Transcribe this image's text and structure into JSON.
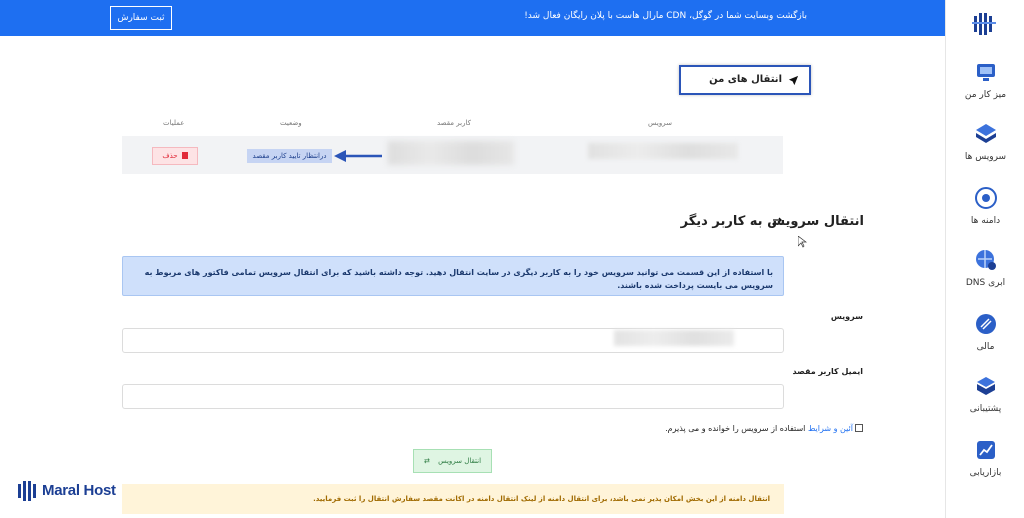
{
  "topbar": {
    "message": "بازگشت وبسایت شما در گوگل، CDN مارال هاست با پلان رایگان فعال شد!",
    "order_button": "ثبت سفارش",
    "color": "#1e6ff1"
  },
  "sidebar": {
    "items": [
      {
        "label": "میز کار من",
        "icon": "desk-icon"
      },
      {
        "label": "سرویس ها",
        "icon": "services-icon"
      },
      {
        "label": "دامنه ها",
        "icon": "domains-icon"
      },
      {
        "label": "DNS ابری",
        "icon": "cloud-dns-icon"
      },
      {
        "label": "مالی",
        "icon": "finance-icon"
      },
      {
        "label": "پشتیبانی",
        "icon": "support-icon"
      },
      {
        "label": "بازاریابی",
        "icon": "marketing-icon"
      }
    ]
  },
  "transfers": {
    "tab_label": "انتقال های من",
    "headers": {
      "service": "سرویس",
      "target_user": "کاربر مقصد",
      "status": "وضعیت",
      "actions": "عملیات"
    },
    "row": {
      "status": "درانتظار تایید کاربر مقصد",
      "delete_label": "حذف"
    }
  },
  "transfer_form": {
    "title": "انتقال سرویس به کاربر دیگر",
    "info": "با استفاده از این قسمت می توانید سرویس خود را به کاربر دیگری در سایت انتقال دهید. توجه داشته باشید که برای انتقال سرویس تمامی فاکتور های مربوط به سرویس می بایست پرداخت شده باشند.",
    "service_label": "سرویس",
    "email_label": "ایمیل کاربر مقصد",
    "terms_link": "آئین و شرایط",
    "terms_text": "استفاده از سرویس را خوانده و می پذیرم.",
    "submit_label": "انتقال سرویس",
    "warning": "انتقال دامنه از این بخش امکان پذیر نمی باشد، برای انتقال دامنه از لینک انتقال دامنه در اکانت مقصد سفارش انتقال را ثبت فرمایید."
  },
  "brand": {
    "name": "Maral Host",
    "color": "#1c3f94"
  }
}
